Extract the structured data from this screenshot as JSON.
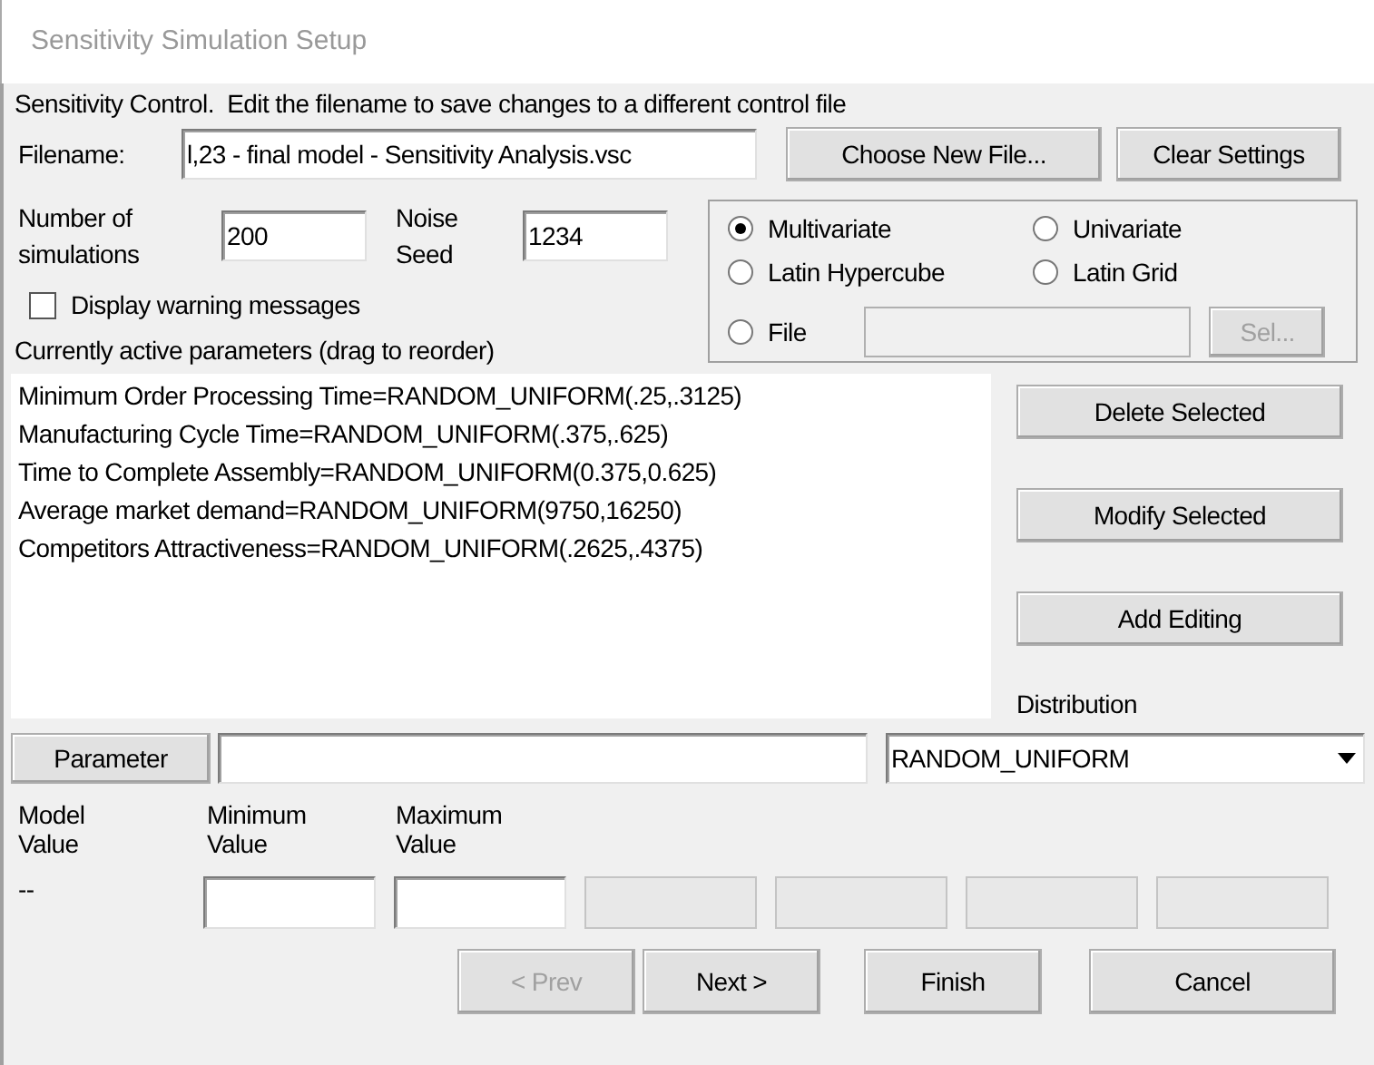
{
  "window": {
    "title": "Sensitivity Simulation Setup"
  },
  "instructions": "Sensitivity Control.  Edit the filename to save changes to a different control file",
  "filename": {
    "label": "Filename:",
    "value": "l,23 - final model - Sensitivity Analysis.vsc"
  },
  "file_buttons": [
    {
      "label": "Choose New File..."
    },
    {
      "label": "Clear Settings"
    }
  ],
  "simulations": {
    "label": "Number of simulations",
    "value": "200"
  },
  "noise_seed": {
    "label": "Noise Seed",
    "value": "1234"
  },
  "display_warnings": {
    "label": "Display warning messages",
    "checked": false
  },
  "method_options": [
    {
      "kind": "radio",
      "label": "Multivariate",
      "selected": true
    },
    {
      "kind": "radio",
      "label": "Univariate",
      "selected": false
    },
    {
      "kind": "radio",
      "label": "Latin Hypercube",
      "selected": false
    },
    {
      "kind": "radio",
      "label": "Latin Grid",
      "selected": false
    },
    {
      "kind": "file",
      "label": "File",
      "selected": false,
      "button": {
        "label": "Sel...",
        "disabled": true
      }
    }
  ],
  "parameters_label": "Currently active parameters (drag to reorder)",
  "parameters": [
    "Minimum Order Processing Time=RANDOM_UNIFORM(.25,.3125)",
    "Manufacturing Cycle Time=RANDOM_UNIFORM(.375,.625)",
    "Time to Complete Assembly=RANDOM_UNIFORM(0.375,0.625)",
    "Average market demand=RANDOM_UNIFORM(9750,16250)",
    "Competitors Attractiveness=RANDOM_UNIFORM(.2625,.4375)"
  ],
  "side_buttons": [
    {
      "label": "Delete Selected"
    },
    {
      "label": "Modify Selected"
    },
    {
      "label": "Add Editing"
    }
  ],
  "distribution_label": "Distribution",
  "parameter_button": {
    "label": "Parameter"
  },
  "distribution": {
    "value": "RANDOM_UNIFORM"
  },
  "value_columns": [
    {
      "label": "Model Value"
    },
    {
      "label": "Minimum Value"
    },
    {
      "label": "Maximum Value"
    }
  ],
  "model_value": "--",
  "value_fields": [
    {
      "disabled": false
    },
    {
      "disabled": false
    },
    {
      "disabled": true
    },
    {
      "disabled": true
    },
    {
      "disabled": true
    },
    {
      "disabled": true
    }
  ],
  "nav_buttons": [
    {
      "label": "< Prev",
      "disabled": true
    },
    {
      "label": "Next >",
      "disabled": false
    },
    {
      "label": "Finish",
      "disabled": false
    },
    {
      "label": "Cancel",
      "disabled": false
    }
  ]
}
